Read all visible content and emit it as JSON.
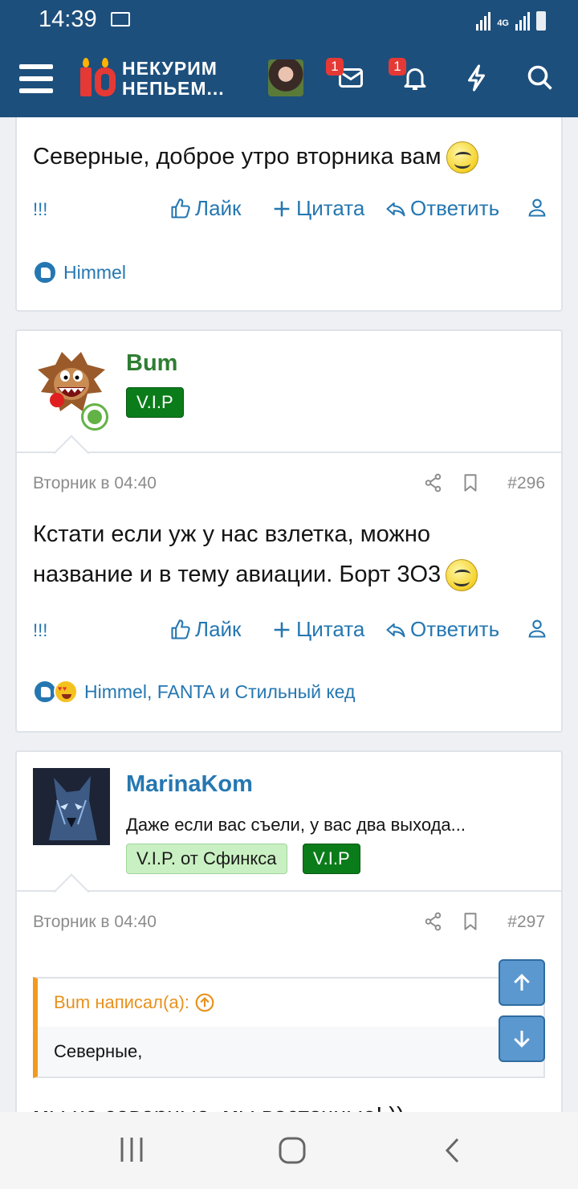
{
  "status_bar": {
    "time": "14:39",
    "network": "4G"
  },
  "header": {
    "logo_line1": "НЕКУРИМ",
    "logo_line2": "НЕПЬЕМ...",
    "inbox_badge": "1",
    "alerts_badge": "1"
  },
  "post1": {
    "text": "Северные, доброе утро вторника вам",
    "reactions_names": "Himmel"
  },
  "actions": {
    "report": "!!!",
    "like": "Лайк",
    "quote": "Цитата",
    "reply": "Ответить"
  },
  "post2": {
    "username": "Bum",
    "banner": "V.I.P",
    "date": "Вторник в 04:40",
    "number": "#296",
    "text_line1": "Кстати если уж у нас взлетка, можно",
    "text_line2": "название и в тему авиации. Борт 3О3",
    "reactions_names": "Himmel, FANTA и Стильный кед"
  },
  "post3": {
    "username": "MarinaKom",
    "user_title": "Даже если вас съели, у вас два выхода...",
    "banner1": "V.I.P. от Сфинкса",
    "banner2": "V.I.P",
    "date": "Вторник в 04:40",
    "number": "#297",
    "quote_author": "Bum написал(а):",
    "quote_text": "Северные,",
    "text_partial": "мы не северные, мы восточные! ))"
  },
  "colors": {
    "header_bg": "#1d4f7c",
    "link": "#2577b1",
    "username_green": "#2f7d32",
    "vip_green": "#0b7c1a",
    "quote_orange": "#e8911d"
  }
}
